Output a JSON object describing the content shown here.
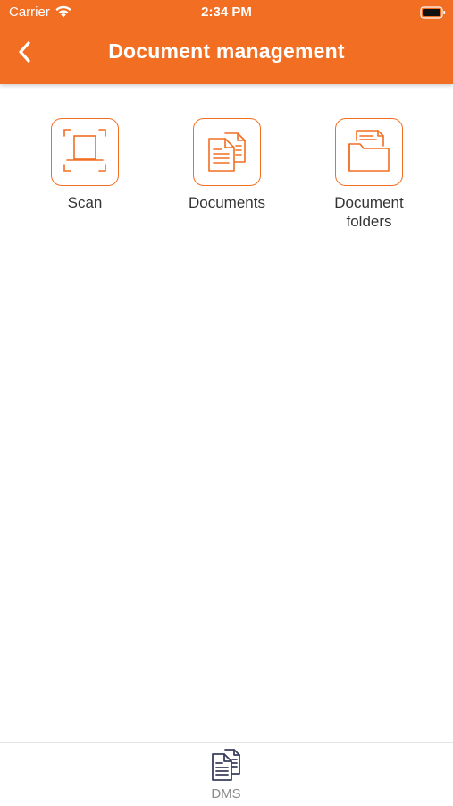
{
  "status_bar": {
    "carrier": "Carrier",
    "time": "2:34 PM"
  },
  "nav": {
    "title": "Document management",
    "back_icon": "chevron-left-icon"
  },
  "tiles": [
    {
      "label": "Scan",
      "icon": "scan-icon"
    },
    {
      "label": "Documents",
      "icon": "documents-icon"
    },
    {
      "label": "Document\nfolders",
      "icon": "folder-icon"
    }
  ],
  "tab_bar": {
    "items": [
      {
        "label": "DMS",
        "icon": "dms-document-icon"
      }
    ]
  },
  "colors": {
    "accent": "#f26e22",
    "tab_icon": "#3a3f5c",
    "text": "#333333",
    "tab_label": "#8a8a8a"
  }
}
